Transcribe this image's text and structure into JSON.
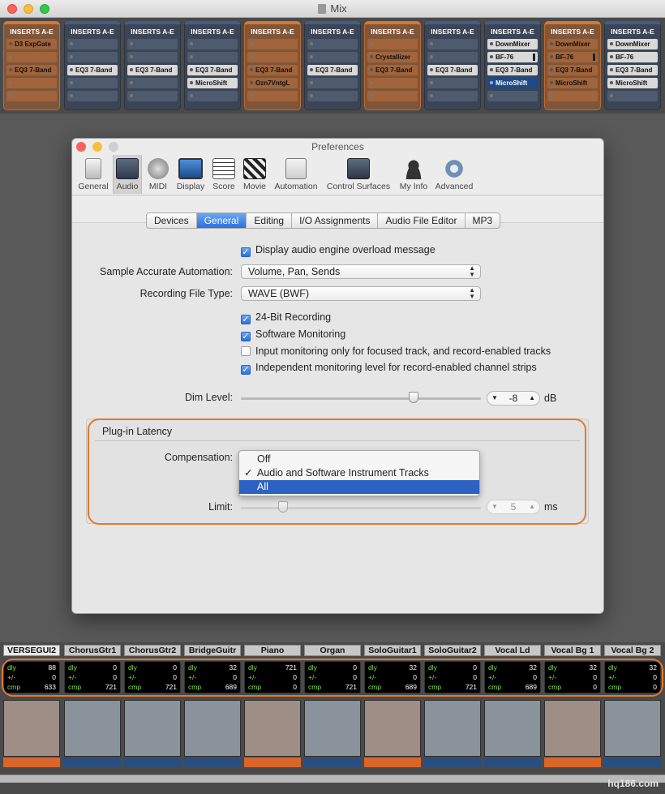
{
  "window": {
    "title": "Mix"
  },
  "mixer": {
    "inserts_header": "INSERTS A-E",
    "strips": [
      {
        "slots": [
          "D3 ExpGate",
          "",
          "EQ3 7-Band",
          "",
          ""
        ]
      },
      {
        "slots": [
          "",
          "",
          "EQ3 7-Band",
          "",
          ""
        ]
      },
      {
        "slots": [
          "",
          "",
          "EQ3 7-Band",
          "",
          ""
        ]
      },
      {
        "slots": [
          "",
          "",
          "EQ3 7-Band",
          "MicroShift",
          ""
        ]
      },
      {
        "slots": [
          "",
          "",
          "EQ3 7-Band",
          "Ozn7VntgL",
          ""
        ]
      },
      {
        "slots": [
          "",
          "",
          "EQ3 7-Band",
          "",
          ""
        ]
      },
      {
        "slots": [
          "",
          "Crystallizer",
          "EQ3 7-Band",
          "",
          ""
        ]
      },
      {
        "slots": [
          "",
          "",
          "EQ3 7-Band",
          "",
          ""
        ]
      },
      {
        "slots": [
          "DownMixer",
          "BF-76",
          "EQ3 7-Band",
          "MicroShift",
          ""
        ]
      },
      {
        "slots": [
          "DownMixer",
          "BF-76",
          "EQ3 7-Band",
          "MicroShift",
          ""
        ]
      },
      {
        "slots": [
          "DownMixer",
          "BF-76",
          "EQ3 7-Band",
          "MicroShift",
          ""
        ]
      }
    ],
    "tracks": [
      {
        "name": "VERSEGUI2",
        "dly": "88",
        "pm": "0",
        "cmp": "633"
      },
      {
        "name": "ChorusGtr1",
        "dly": "0",
        "pm": "0",
        "cmp": "721"
      },
      {
        "name": "ChorusGtr2",
        "dly": "0",
        "pm": "0",
        "cmp": "721"
      },
      {
        "name": "BridgeGuitr",
        "dly": "32",
        "pm": "0",
        "cmp": "689"
      },
      {
        "name": "Piano",
        "dly": "721",
        "pm": "0",
        "cmp": "0"
      },
      {
        "name": "Organ",
        "dly": "0",
        "pm": "0",
        "cmp": "721"
      },
      {
        "name": "SoloGuitar1",
        "dly": "32",
        "pm": "0",
        "cmp": "689"
      },
      {
        "name": "SoloGuitar2",
        "dly": "0",
        "pm": "0",
        "cmp": "721"
      },
      {
        "name": "Vocal Ld",
        "dly": "32",
        "pm": "0",
        "cmp": "689"
      },
      {
        "name": "Vocal Bg 1",
        "dly": "32",
        "pm": "0",
        "cmp": "0"
      },
      {
        "name": "Vocal Bg 2",
        "dly": "32",
        "pm": "0",
        "cmp": "0"
      }
    ],
    "lat_labels": {
      "dly": "dly",
      "pm": "+/-",
      "cmp": "cmp"
    }
  },
  "prefs": {
    "title": "Preferences",
    "toolbar": [
      "General",
      "Audio",
      "MIDI",
      "Display",
      "Score",
      "Movie",
      "Automation",
      "Control Surfaces",
      "My Info",
      "Advanced"
    ],
    "tabs": [
      "Devices",
      "General",
      "Editing",
      "I/O Assignments",
      "Audio File Editor",
      "MP3"
    ],
    "overload_label": "Display audio engine overload message",
    "automation_label": "Sample Accurate Automation:",
    "automation_value": "Volume, Pan, Sends",
    "filetype_label": "Recording File Type:",
    "filetype_value": "WAVE (BWF)",
    "chk_24bit": "24-Bit Recording",
    "chk_software": "Software Monitoring",
    "chk_input": "Input monitoring only for focused track, and record-enabled tracks",
    "chk_independent": "Independent monitoring level for record-enabled channel strips",
    "dim_label": "Dim Level:",
    "dim_value": "-8",
    "dim_unit": "dB",
    "latency_title": "Plug-in Latency",
    "comp_label": "Compensation:",
    "comp_options": [
      "Off",
      "Audio and Software Instrument Tracks",
      "All"
    ],
    "limit_label": "Limit:",
    "limit_value": "5",
    "limit_unit": "ms"
  },
  "watermark": "hq186.com"
}
